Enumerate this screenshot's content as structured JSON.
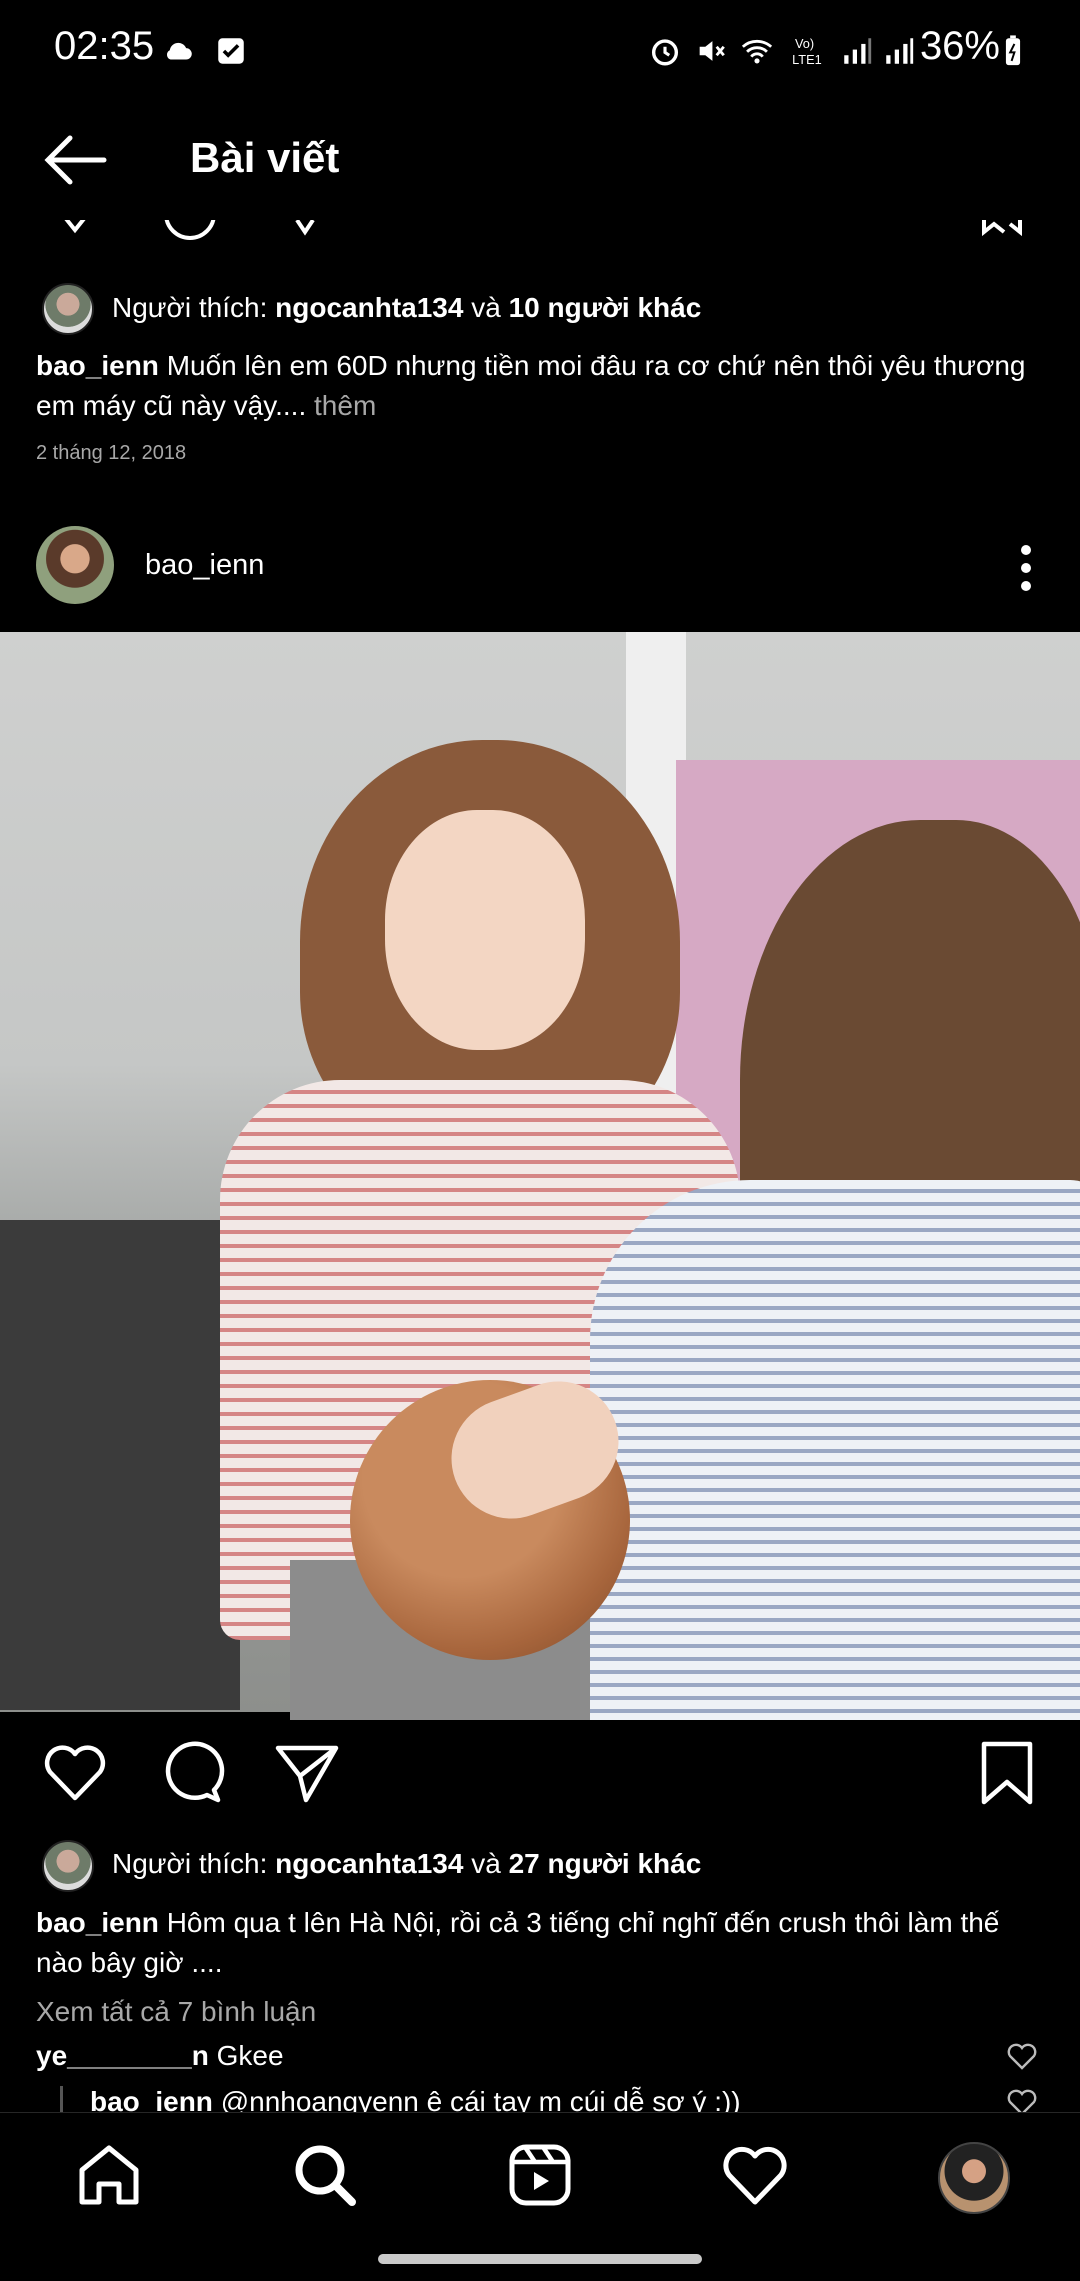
{
  "status_bar": {
    "time": "02:35",
    "battery": "36%"
  },
  "header": {
    "title": "Bài viết"
  },
  "prev_post": {
    "likes_prefix": "Người thích: ",
    "likes_user": "ngocanhta134",
    "likes_and": " và ",
    "likes_others": "10 người khác",
    "caption_user": "bao_ienn",
    "caption_text": " Muốn lên em 60D nhưng tiền moi đâu ra cơ chứ nên thôi yêu thương em máy cũ này vậy....",
    "more": " thêm",
    "date": "2 tháng 12, 2018"
  },
  "post": {
    "username": "bao_ienn",
    "likes_prefix": "Người thích: ",
    "likes_user": "ngocanhta134",
    "likes_and": " và ",
    "likes_others": "27 người khác",
    "caption_user": "bao_ienn",
    "caption_text": " Hôm qua t lên Hà Nội, rồi cả 3 tiếng chỉ nghĩ đến crush thôi làm thế nào bây giờ ....",
    "view_comments": "Xem tất cả 7 bình luận",
    "comments": [
      {
        "user": "ye________n",
        "text": " Gkee"
      },
      {
        "user": "bao_ienn",
        "text": " @nnhoangyenn ê cái tay m cúi dễ sợ ý :))"
      }
    ]
  },
  "icons": [
    "back-arrow-icon",
    "heart-icon",
    "comment-icon",
    "share-icon",
    "bookmark-icon",
    "home-icon",
    "search-icon",
    "reels-icon",
    "activity-icon",
    "profile-avatar"
  ]
}
